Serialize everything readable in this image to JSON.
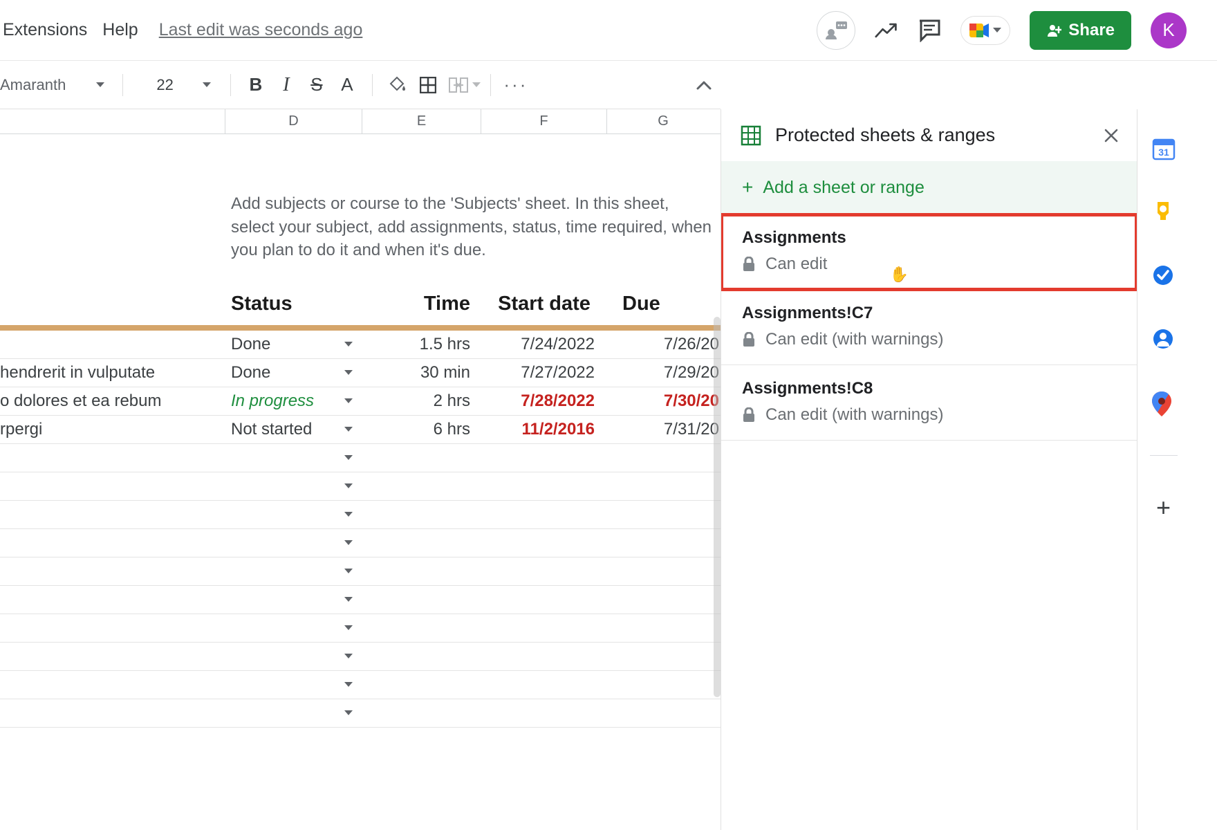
{
  "header": {
    "menu": {
      "extensions": "Extensions",
      "help": "Help"
    },
    "last_edit": "Last edit was seconds ago",
    "share": "Share",
    "avatar_initial": "K"
  },
  "toolbar": {
    "font": "Amaranth",
    "size": "22"
  },
  "columns": {
    "d": "D",
    "e": "E",
    "f": "F",
    "g": "G"
  },
  "helper_text": "Add subjects or course to the 'Subjects' sheet. In this sheet, select your subject, add assignments, status, time required, when you plan to do it and when it's due.",
  "table_headers": {
    "status": "Status",
    "time": "Time",
    "start": "Start date",
    "due": "Due"
  },
  "rows": [
    {
      "a": "",
      "status": "Done",
      "status_class": "",
      "time": "1.5 hrs",
      "start": "7/24/2022",
      "start_red": false,
      "due": "7/26/20",
      "due_red": false
    },
    {
      "a": "hendrerit in vulputate",
      "status": "Done",
      "status_class": "",
      "time": "30 min",
      "start": "7/27/2022",
      "start_red": false,
      "due": "7/29/20",
      "due_red": false
    },
    {
      "a": "o dolores et ea rebum",
      "status": "In progress",
      "status_class": "inprogress",
      "time": "2 hrs",
      "start": "7/28/2022",
      "start_red": true,
      "due": "7/30/20",
      "due_red": true
    },
    {
      "a": "rpergi",
      "status": "Not started",
      "status_class": "",
      "time": "6 hrs",
      "start": "11/2/2016",
      "start_red": true,
      "due": "7/31/20",
      "due_red": false
    }
  ],
  "panel": {
    "title": "Protected sheets & ranges",
    "add_label": "Add a sheet or range",
    "items": [
      {
        "name": "Assignments",
        "sub": "Can edit",
        "highlight": true,
        "cursor": true
      },
      {
        "name": "Assignments!C7",
        "sub": "Can edit (with warnings)",
        "highlight": false,
        "cursor": false
      },
      {
        "name": "Assignments!C8",
        "sub": "Can edit (with warnings)",
        "highlight": false,
        "cursor": false
      }
    ]
  },
  "rail": {
    "calendar_day": "31"
  }
}
